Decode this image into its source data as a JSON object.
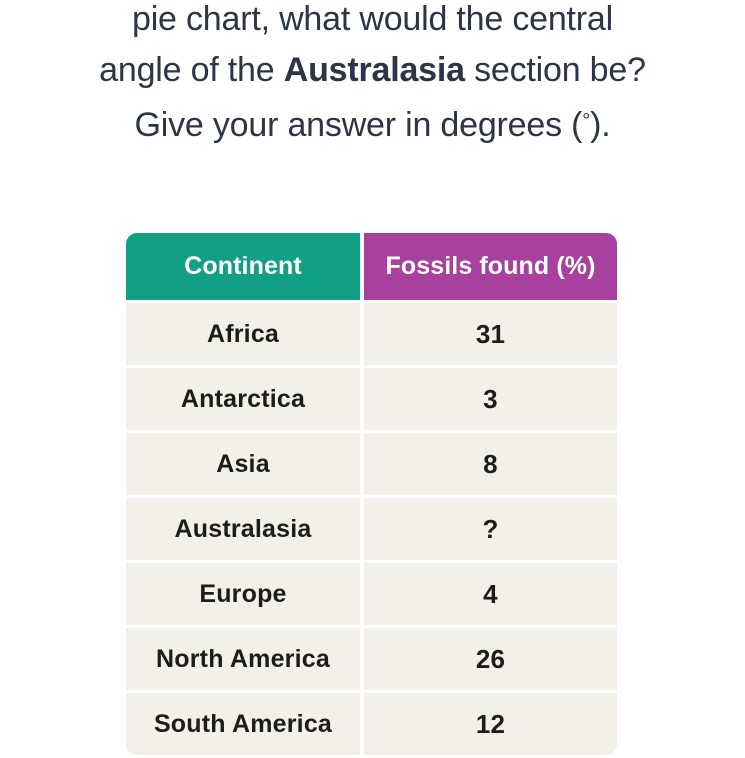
{
  "question": {
    "line1": "pie chart, what would the central",
    "line2_pre": "angle of the ",
    "line2_bold": "Australasia",
    "line2_post": " section be?",
    "line3_pre": "Give your answer in degrees (",
    "line3_degree": "°",
    "line3_post": ")."
  },
  "table": {
    "headers": {
      "continent": "Continent",
      "value": "Fossils found (%)"
    },
    "header_colors": {
      "continent_bg": "#12A085",
      "value_bg": "#A8409E",
      "header_text": "#FFFFFF"
    },
    "row_bg": "#F2F0E9",
    "row_text": "#1C1C1A",
    "rows": [
      {
        "continent": "Africa",
        "value": "31"
      },
      {
        "continent": "Antarctica",
        "value": "3"
      },
      {
        "continent": "Asia",
        "value": "8"
      },
      {
        "continent": "Australasia",
        "value": "?"
      },
      {
        "continent": "Europe",
        "value": "4"
      },
      {
        "continent": "North America",
        "value": "26"
      },
      {
        "continent": "South America",
        "value": "12"
      }
    ]
  },
  "chart_data": {
    "type": "table",
    "title": "Fossils found (%) by continent",
    "categories": [
      "Africa",
      "Antarctica",
      "Asia",
      "Australasia",
      "Europe",
      "North America",
      "South America"
    ],
    "values": [
      31,
      3,
      8,
      null,
      4,
      26,
      12
    ],
    "unknown_category": "Australasia",
    "unknown_marker": "?",
    "xlabel": "Continent",
    "ylabel": "Fossils found (%)"
  }
}
